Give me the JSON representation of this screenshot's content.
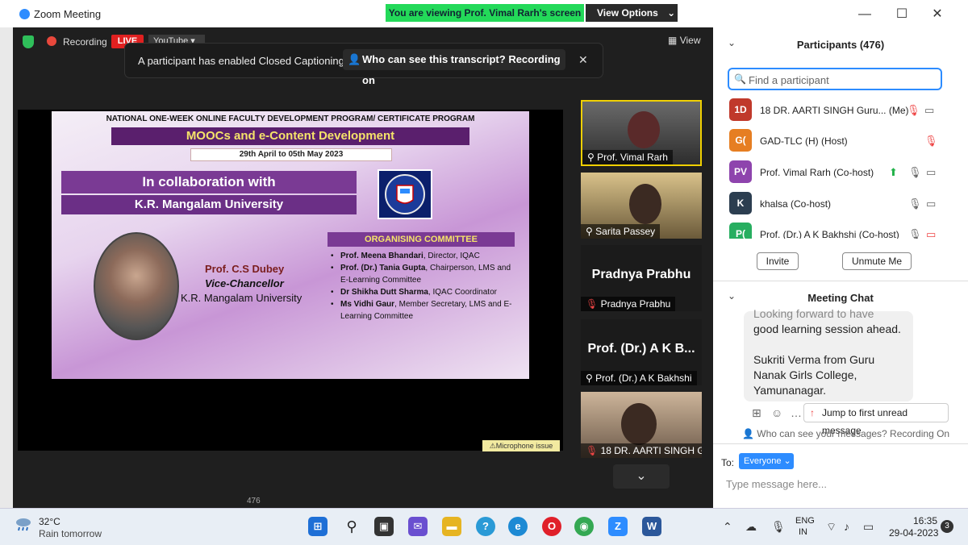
{
  "window": {
    "title": "Zoom Meeting",
    "viewing_banner": "You are viewing Prof. Vimal Rarh's screen",
    "view_options": "View Options",
    "minimize": "—",
    "maximize": "☐",
    "close": "✕"
  },
  "meeting": {
    "recording_label": "Recording",
    "live_label": "LIVE",
    "youtube_label": "YouTube",
    "view_label": "View",
    "cc_banner": {
      "message": "A participant has enabled Closed Captioning",
      "transcript_pill": "Who can see this transcript? Recording on",
      "close": "✕"
    },
    "mic_issue": "⚠Microphone issue",
    "bottom_count": "476"
  },
  "slide": {
    "header": "NATIONAL ONE-WEEK ONLINE FACULTY DEVELOPMENT PROGRAM/ CERTIFICATE PROGRAM",
    "title": "MOOCs and e-Content Development",
    "date": "29th April to 05th May 2023",
    "collab": "In collaboration with",
    "university": "K.R. Mangalam University",
    "logo_text": "K.R. MANGALAM UNIVERSITY",
    "vc_name": "Prof. C.S Dubey",
    "vc_role": "Vice-Chancellor",
    "vc_univ": "K.R. Mangalam University",
    "committee_title": "ORGANISING COMMITTEE",
    "members": [
      {
        "name": "Prof. Meena Bhandari",
        "role": ", Director, IQAC"
      },
      {
        "name": "Prof. (Dr.) Tania Gupta",
        "role": ", Chairperson, LMS and E-Learning Committee"
      },
      {
        "name": "Dr Shikha Dutt Sharma",
        "role": ", IQAC Coordinator"
      },
      {
        "name": "Ms Vidhi Gaur",
        "role": ", Member Secretary, LMS and E-Learning Committee"
      }
    ]
  },
  "tiles": [
    {
      "name": "Prof. Vimal Rarh"
    },
    {
      "name": "Sarita Passey"
    },
    {
      "name": "Pradnya Prabhu",
      "big": "Pradnya Prabhu"
    },
    {
      "name": "Prof. (Dr.) A K Bakhshi",
      "big": "Prof. (Dr.) A K B..."
    },
    {
      "name": "18 DR. AARTI SINGH G..."
    }
  ],
  "participants": {
    "title": "Participants (476)",
    "search_placeholder": "Find a participant",
    "list": [
      {
        "initials": "1D",
        "name": "18 DR. AARTI SINGH Guru... (Me)",
        "color": "#c0392b"
      },
      {
        "initials": "G(",
        "name": "GAD-TLC (H) (Host)",
        "color": "#e67e22"
      },
      {
        "initials": "PV",
        "name": "Prof. Vimal Rarh (Co-host)",
        "color": "#8e44ad"
      },
      {
        "initials": "K",
        "name": "khalsa (Co-host)",
        "color": "#2c3e50"
      },
      {
        "initials": "P(",
        "name": "Prof. (Dr.) A K Bakhshi (Co-host)",
        "color": "#27ae60"
      }
    ],
    "invite": "Invite",
    "unmute": "Unmute Me"
  },
  "chat": {
    "title": "Meeting Chat",
    "message_top": "Looking forward to have",
    "message_line2": "good learning session ahead.",
    "message_2": "Sukriti Verma from Guru Nanak Girls College, Yamunanagar.",
    "jump": "Jump to first unread message",
    "who_can_see": "Who can see your messages? Recording On",
    "to": "To:",
    "recipient": "Everyone",
    "input_placeholder": "Type message here..."
  },
  "taskbar": {
    "temp": "32°C",
    "weather": "Rain tomorrow",
    "lang_top": "ENG",
    "lang_bottom": "IN",
    "time": "16:35",
    "date": "29-04-2023",
    "notifications": "3"
  }
}
